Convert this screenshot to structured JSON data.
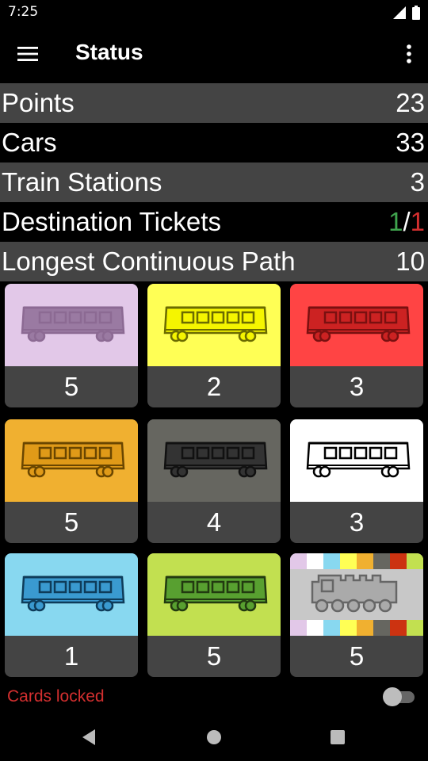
{
  "statusbar": {
    "time": "7:25"
  },
  "appbar": {
    "title": "Status"
  },
  "stats": {
    "points_label": "Points",
    "points_value": "23",
    "cars_label": "Cars",
    "cars_value": "33",
    "stations_label": "Train Stations",
    "stations_value": "3",
    "tickets_label": "Destination Tickets",
    "tickets_completed": "1",
    "tickets_sep": "/",
    "tickets_total": "1",
    "path_label": "Longest Continuous Path",
    "path_value": "10"
  },
  "cards": [
    {
      "name": "purple",
      "color": "#e2c8e8",
      "stroke": "#8c6a93",
      "fill": "#9a7aa2",
      "count": "5"
    },
    {
      "name": "yellow",
      "color": "#ffff55",
      "stroke": "#6b6b00",
      "fill": "#f5f500",
      "count": "2"
    },
    {
      "name": "red",
      "color": "#ff4444",
      "stroke": "#7a1010",
      "fill": "#cc2222",
      "count": "3"
    },
    {
      "name": "orange",
      "color": "#f0b030",
      "stroke": "#6a4600",
      "fill": "#e09a18",
      "count": "5"
    },
    {
      "name": "black",
      "color": "#666660",
      "stroke": "#111111",
      "fill": "#333333",
      "count": "4"
    },
    {
      "name": "white",
      "color": "#ffffff",
      "stroke": "#000000",
      "fill": "#ffffff",
      "count": "3"
    },
    {
      "name": "blue",
      "color": "#88d8f0",
      "stroke": "#0e3c5a",
      "fill": "#3a9ad0",
      "count": "1"
    },
    {
      "name": "green",
      "color": "#c2e050",
      "stroke": "#223a10",
      "fill": "#58a030",
      "count": "5"
    },
    {
      "name": "locomotive",
      "color": "#c8c8c8",
      "stroke": "#666666",
      "fill": "#aaaaaa",
      "count": "5"
    }
  ],
  "locomotive_stripes": [
    "#e2c8e8",
    "#ffffff",
    "#88d8f0",
    "#ffff55",
    "#f0b030",
    "#666660",
    "#cc3311",
    "#c2e050"
  ],
  "footer": {
    "locked_label": "Cards locked",
    "toggle_on": false
  },
  "icons": {
    "menu": "hamburger-icon",
    "more": "more-vert-icon",
    "signal": "signal-icon",
    "battery": "battery-icon",
    "back": "back-icon",
    "home": "home-icon",
    "recent": "recent-apps-icon"
  }
}
